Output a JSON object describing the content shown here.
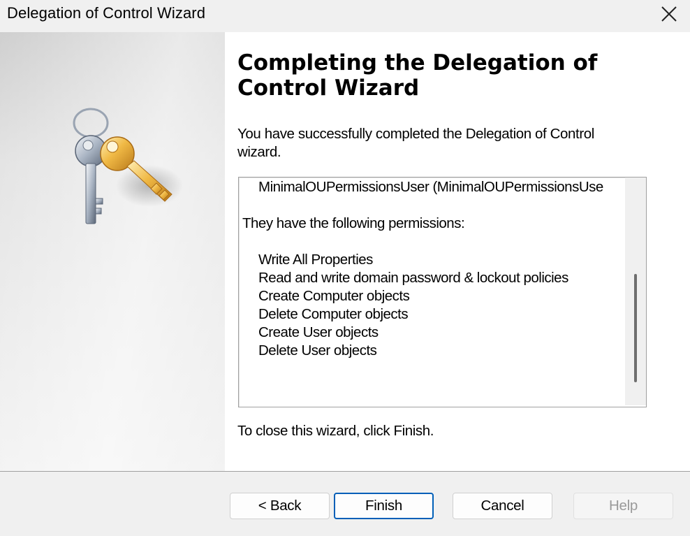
{
  "window": {
    "title": "Delegation of Control Wizard"
  },
  "page": {
    "heading_line1": "Completing the Delegation of",
    "heading_line2": "Control Wizard",
    "intro_line1": "You have successfully completed the Delegation of Control",
    "intro_line2": "wizard.",
    "summary": {
      "user_line": "MinimalOUPermissionsUser (MinimalOUPermissionsUse",
      "permissions_intro": "They have the following permissions:",
      "permissions": [
        "Write All Properties",
        "Read and write domain password & lockout policies",
        "Create Computer objects",
        "Delete Computer objects",
        "Create User objects",
        "Delete User objects"
      ]
    },
    "closing_text": "To close this wizard, click Finish."
  },
  "buttons": {
    "back": "< Back",
    "finish": "Finish",
    "cancel": "Cancel",
    "help": "Help"
  },
  "icons": {
    "close": "close-icon",
    "wizard_graphic": "keys-icon"
  },
  "colors": {
    "default_button_border": "#005fb8",
    "disabled_text": "#9a9a9a",
    "key_gold": "#e2a93a",
    "key_silver": "#8a96a6"
  }
}
